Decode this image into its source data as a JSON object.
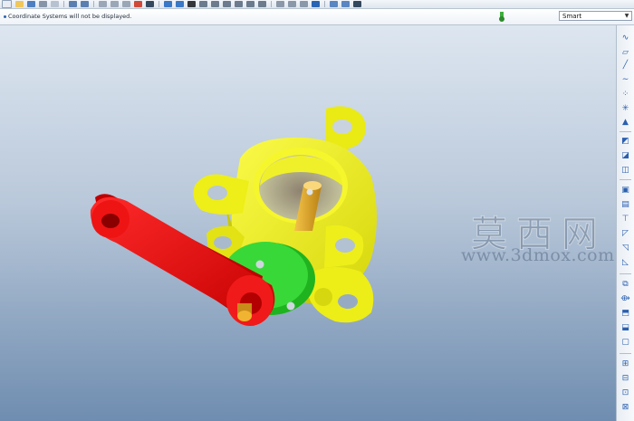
{
  "message_bar": {
    "text": "Coordinate Systems will not be displayed."
  },
  "filter": {
    "selected": "Smart"
  },
  "watermark": {
    "chinese": "莫西网",
    "url": "www.3dmox.com"
  },
  "model": {
    "colors": {
      "housing": "#f2f21a",
      "lever": "#e51212",
      "flange": "#22cc22",
      "shaft": "#e0a020",
      "gray_disc": "#c8b89a"
    }
  },
  "icons": {
    "top_toolbar": [
      "new-icon",
      "open-icon",
      "save-icon",
      "print-icon",
      "email-icon",
      "undo-icon",
      "redo-icon",
      "cut-icon",
      "copy-icon",
      "paste-icon",
      "regenerate-icon",
      "window-icon",
      "zoom-in-icon",
      "zoom-out-icon",
      "refit-icon",
      "orient-icon",
      "repaint-icon",
      "datum-planes-icon",
      "datum-axes-icon",
      "datum-points-icon",
      "csys-icon",
      "help-icon"
    ],
    "right_toolbar": [
      "sketch-icon",
      "plane-icon",
      "axis-icon",
      "curve-icon",
      "point-icon",
      "csys-icon",
      "analysis-icon",
      "extrude-icon",
      "revolve-icon",
      "sweep-icon",
      "hole-icon",
      "round-icon",
      "chamfer-icon",
      "draft-icon",
      "shell-icon",
      "rib-icon",
      "pattern-icon",
      "mirror-icon",
      "merge-icon",
      "trim-icon",
      "offset-icon",
      "thicken-icon",
      "solidify-icon"
    ]
  }
}
